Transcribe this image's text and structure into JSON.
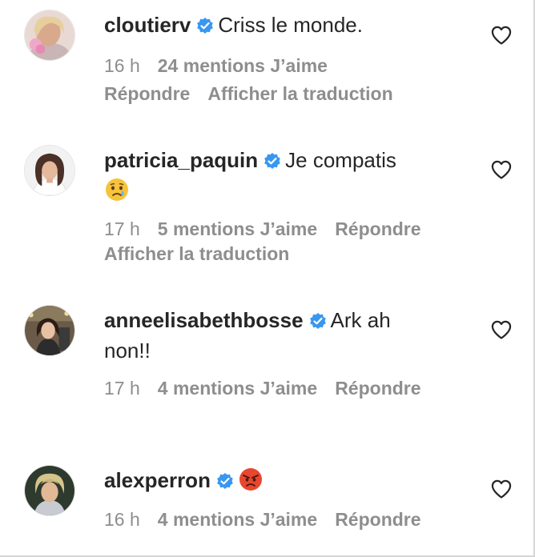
{
  "comments": [
    {
      "username": "cloutierv",
      "text": "Criss le monde.",
      "time": "16 h",
      "likes": "24 mentions J’aime",
      "reply": "Répondre",
      "translate": "Afficher la traduction"
    },
    {
      "username": "patricia_paquin",
      "text": "Je compatis",
      "emoji": "crying-face",
      "time": "17 h",
      "likes": "5 mentions J’aime",
      "reply": "Répondre",
      "translate": "Afficher la traduction"
    },
    {
      "username": "anneelisabethbosse",
      "text_line1": "Ark ah",
      "text_line2": "non!!",
      "time": "17 h",
      "likes": "4 mentions J’aime",
      "reply": "Répondre"
    },
    {
      "username": "alexperron",
      "emoji": "angry-face",
      "time": "16 h",
      "likes": "4 mentions J’aime",
      "reply": "Répondre"
    }
  ],
  "colors": {
    "verified_blue": "#3897f0",
    "meta_gray": "#8e8e8e",
    "text": "#262626"
  }
}
